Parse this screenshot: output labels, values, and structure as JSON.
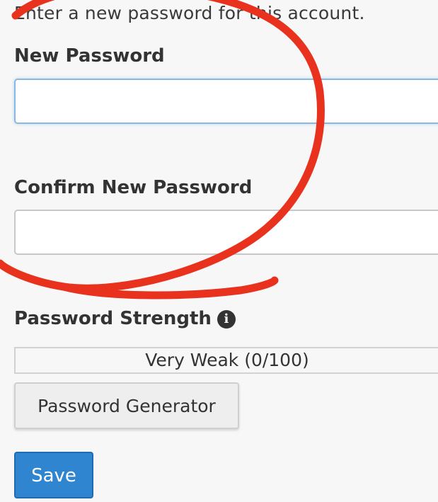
{
  "intro_text": "Enter a new password for this account.",
  "new_password": {
    "label": "New Password",
    "value": ""
  },
  "confirm_password": {
    "label": "Confirm New Password",
    "value": ""
  },
  "strength": {
    "label": "Password Strength",
    "icon": "info-icon",
    "text": "Very Weak (0/100)",
    "score": 0,
    "max": 100
  },
  "buttons": {
    "generator_label": "Password Generator",
    "save_label": "Save"
  },
  "colors": {
    "save_button": "#2f85d0",
    "annotation_stroke": "#e8321e",
    "focus_border": "#8ab8e0"
  }
}
